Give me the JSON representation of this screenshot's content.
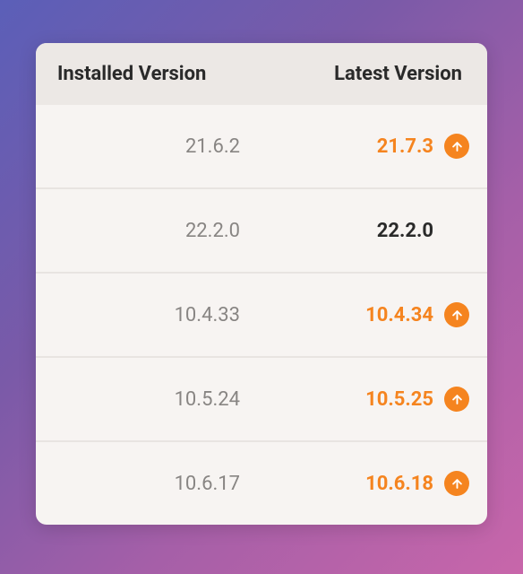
{
  "headers": {
    "installed": "Installed Version",
    "latest": "Latest Version"
  },
  "accent_color": "#f5841f",
  "rows": [
    {
      "installed": "21.6.2",
      "latest": "21.7.3",
      "update": true
    },
    {
      "installed": "22.2.0",
      "latest": "22.2.0",
      "update": false
    },
    {
      "installed": "10.4.33",
      "latest": "10.4.34",
      "update": true
    },
    {
      "installed": "10.5.24",
      "latest": "10.5.25",
      "update": true
    },
    {
      "installed": "10.6.17",
      "latest": "10.6.18",
      "update": true
    }
  ]
}
